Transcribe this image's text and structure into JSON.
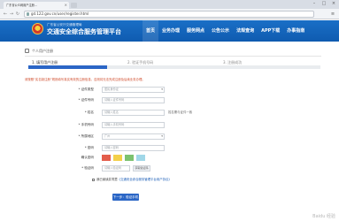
{
  "browser": {
    "tab_title": "广东省公众网用户注册...",
    "url": "gd.122.gov.cn/user/register.html"
  },
  "header": {
    "subtitle": "广东省公安厅交通管理局",
    "title": "交通安全综合服务管理平台",
    "nav": [
      "首页",
      "业务办理",
      "服务网点",
      "公告公示",
      "法规查询",
      "APP下载",
      "办事指南"
    ],
    "accent": "#1565c0"
  },
  "breadcrumb": "个人用户注册",
  "steps": {
    "items": [
      "1. 填写用户注册",
      "2. 验证手机号码",
      "3. 注册成功"
    ],
    "progress": 0.27
  },
  "notice": "请按照“实名制注册”规则填写真实有效的注册信息，否则将无法完成注册及后续业务办理。",
  "form": {
    "fields": [
      {
        "label": "* 证件类型",
        "value": "居民身份证",
        "kind": "select",
        "hint": ""
      },
      {
        "label": "* 证件号码",
        "value": "请输入证件号码",
        "kind": "input",
        "hint": ""
      },
      {
        "label": "* 姓名",
        "value": "请输入姓名",
        "kind": "input",
        "hint": "姓名需与证件一致"
      },
      {
        "label": "* 手机号码",
        "value": "请输入手机号码",
        "kind": "input",
        "hint": ""
      },
      {
        "label": "* 所属地区",
        "value": "广州",
        "kind": "select",
        "hint": ""
      },
      {
        "label": "* 密码",
        "value": "请输入密码",
        "kind": "input",
        "hint": ""
      },
      {
        "label": "确认密码",
        "value": "",
        "kind": "photos",
        "hint": ""
      },
      {
        "label": "* 验证码",
        "value": "请输入验证码",
        "kind": "captcha",
        "hint": ""
      }
    ],
    "photo_colors": [
      "#e35d4b",
      "#f3d04a",
      "#7cc26f",
      "#a0d7e8"
    ],
    "captcha_label": "获取验证码",
    "agree_prefix": "我已阅读并同意",
    "agree_link": "《交通安全综合服务管理平台用户协议》",
    "submit": "下一步：验证手机"
  },
  "watermark": "Baidu 经验"
}
